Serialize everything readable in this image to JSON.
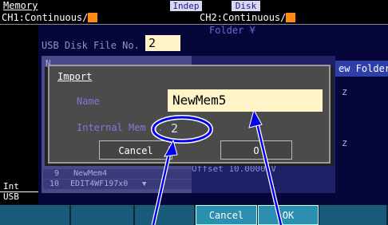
{
  "header": {
    "title": "Memory",
    "mode_indep": "Indep",
    "mode_disk": "Disk"
  },
  "channels": {
    "ch1": "CH1:Continuous/",
    "ch2": "CH2:Continuous/"
  },
  "file_panel": {
    "usb_label": "USB Disk File No.",
    "usb_value": "2",
    "folder_label": "Folder ¥",
    "new_folder": "ew Folder",
    "partial_n": "N",
    "rows": [
      {
        "num": "9",
        "name": "NewMem4"
      },
      {
        "num": "10",
        "name": "EDIT4WF197x0"
      }
    ],
    "offset": "Offset  10.0000 V",
    "hz1": "z",
    "hz2": "z"
  },
  "dialog": {
    "title": "Import",
    "name_label": "Name",
    "name_value": "NewMem5",
    "mem_label": "Internal Mem  o.",
    "mem_value": "2",
    "cancel": "Cancel",
    "ok": "O"
  },
  "left_strip": {
    "int": "Int",
    "usb": "USB"
  },
  "softkeys": {
    "cancel": "Cancel",
    "ok": "OK"
  },
  "colors": {
    "screen_bg": "#06063a",
    "input_bg": "#fff3c8",
    "softkey": "#1a5a7a",
    "annotation": "#0000ee",
    "orange": "#ff8a1a"
  }
}
